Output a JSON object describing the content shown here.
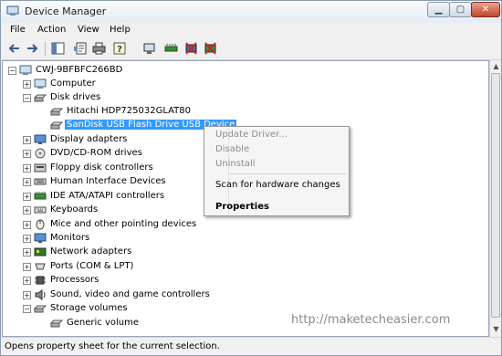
{
  "window": {
    "title": "Device Manager"
  },
  "menu": [
    "File",
    "Action",
    "View",
    "Help"
  ],
  "tree": {
    "root": "CWJ-9BFBFC266BD",
    "categories": [
      {
        "label": "Computer"
      },
      {
        "label": "Disk drives",
        "children": [
          "Hitachi HDP725032GLAT80",
          "SanDisk USB Flash Drive USB Device"
        ]
      },
      {
        "label": "Display adapters"
      },
      {
        "label": "DVD/CD-ROM drives"
      },
      {
        "label": "Floppy disk controllers"
      },
      {
        "label": "Human Interface Devices"
      },
      {
        "label": "IDE ATA/ATAPI controllers"
      },
      {
        "label": "Keyboards"
      },
      {
        "label": "Mice and other pointing devices"
      },
      {
        "label": "Monitors"
      },
      {
        "label": "Network adapters"
      },
      {
        "label": "Ports (COM & LPT)"
      },
      {
        "label": "Processors"
      },
      {
        "label": "Sound, video and game controllers"
      },
      {
        "label": "Storage volumes",
        "children": [
          "Generic volume"
        ]
      }
    ]
  },
  "context_menu": {
    "items": [
      "Update Driver...",
      "Disable",
      "Uninstall",
      "Scan for hardware changes",
      "Properties"
    ]
  },
  "status": "Opens property sheet for the current selection.",
  "watermark": "http://maketecheasier.com",
  "colors": {
    "selection": "#3399ff",
    "disabled_text": "#8d8d8d"
  }
}
